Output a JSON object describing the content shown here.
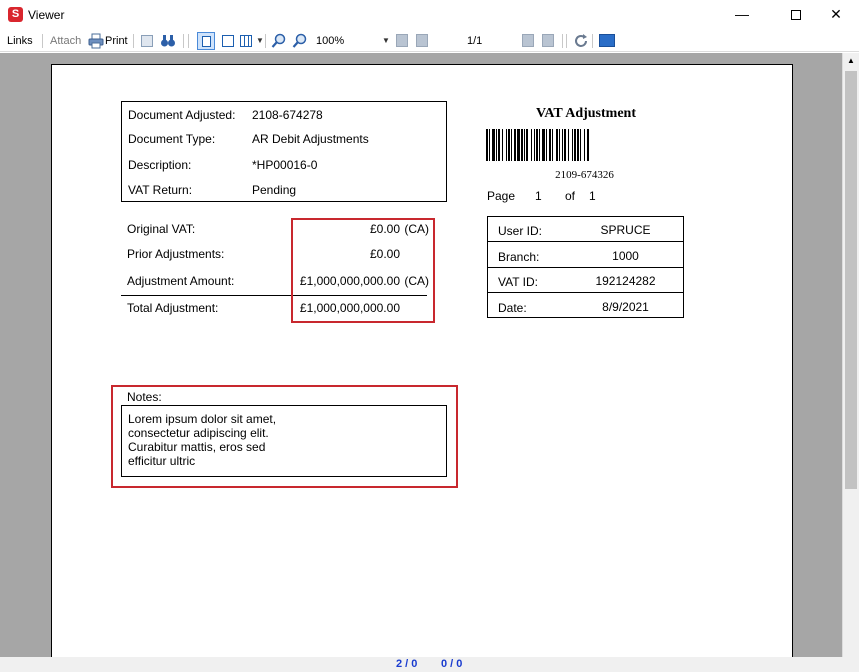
{
  "window": {
    "icon_letter": "S",
    "title": "Viewer",
    "minimize": "—",
    "close": "✕"
  },
  "toolbar": {
    "links": "Links",
    "attach": "Attach",
    "print": "Print",
    "zoom": "100%",
    "page_indicator": "1/1"
  },
  "document": {
    "fields": [
      {
        "label": "Document Adjusted:",
        "value": "2108-674278"
      },
      {
        "label": "Document Type:",
        "value": "AR Debit Adjustments"
      },
      {
        "label": "Description:",
        "value": "*HP00016-0"
      },
      {
        "label": "VAT Return:",
        "value": "Pending"
      }
    ],
    "vat_title": "VAT Adjustment",
    "barcode_number": "2109-674326",
    "page_word": "Page",
    "page_num": "1",
    "of_word": "of",
    "page_total": "1",
    "vat_lines": [
      {
        "label": "Original VAT:",
        "value": "£0.00",
        "suffix": "(CA)"
      },
      {
        "label": "Prior Adjustments:",
        "value": "£0.00",
        "suffix": ""
      },
      {
        "label": "Adjustment Amount:",
        "value": "£1,000,000,000.00",
        "suffix": "(CA)"
      },
      {
        "label": "Total Adjustment:",
        "value": "£1,000,000,000.00",
        "suffix": ""
      }
    ],
    "user_info": [
      {
        "label": "User ID:",
        "value": "SPRUCE"
      },
      {
        "label": "Branch:",
        "value": "1000"
      },
      {
        "label": "VAT ID:",
        "value": "192124282"
      },
      {
        "label": "Date:",
        "value": "8/9/2021"
      }
    ],
    "notes_label": "Notes:",
    "notes_lines": [
      "Lorem ipsum dolor sit amet,",
      "consectetur adipiscing elit.",
      "Curabitur mattis, eros sed",
      "efficitur ultric"
    ]
  },
  "status": {
    "left": "2 / 0",
    "right": "0 / 0"
  },
  "colors": {
    "highlight_red": "#c8282e",
    "status_blue": "#1a3ccf",
    "viewer_bg": "#a6a6a6"
  }
}
